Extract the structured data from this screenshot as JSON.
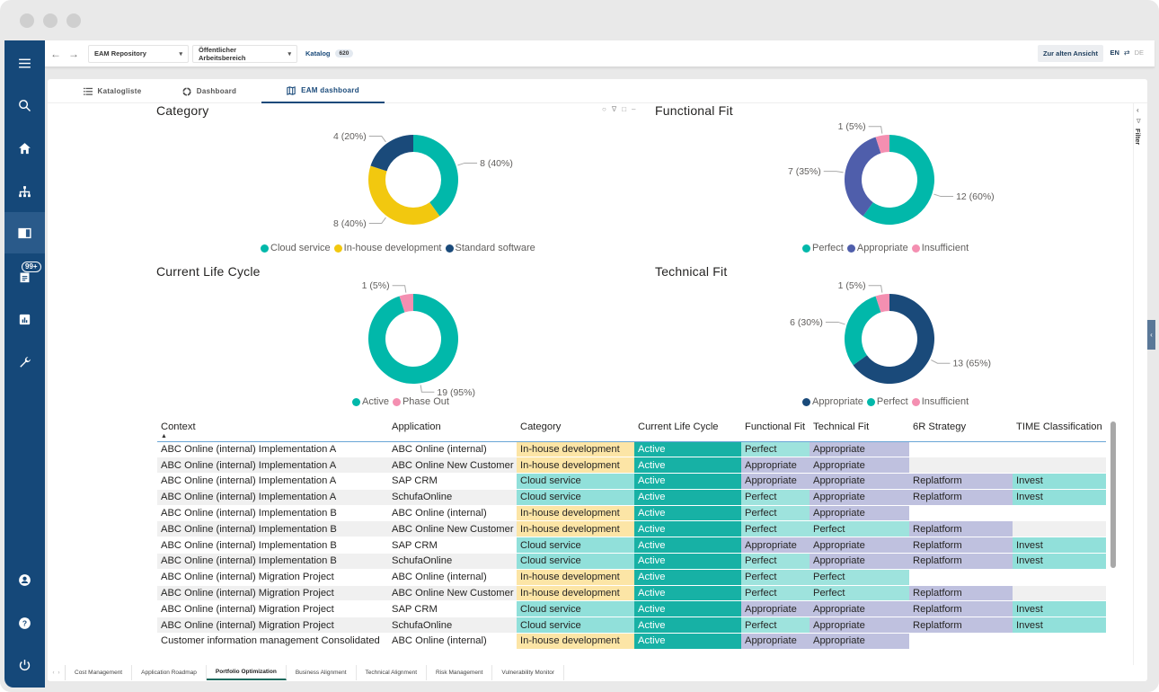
{
  "window": {
    "controls": [
      "close",
      "minimize",
      "maximize"
    ]
  },
  "sidebar": {
    "items": [
      {
        "name": "menu",
        "icon": "hamburger-icon"
      },
      {
        "name": "search",
        "icon": "search-icon"
      },
      {
        "name": "home",
        "icon": "home-icon"
      },
      {
        "name": "hierarchy",
        "icon": "sitemap-icon"
      },
      {
        "name": "catalog",
        "icon": "book-icon",
        "active": true
      },
      {
        "name": "notifications",
        "icon": "document-icon",
        "badge": "99+"
      },
      {
        "name": "reports",
        "icon": "bar-chart-icon"
      },
      {
        "name": "tools",
        "icon": "wrench-icon"
      },
      {
        "name": "profile",
        "icon": "user-icon"
      },
      {
        "name": "help",
        "icon": "help-icon"
      },
      {
        "name": "logout",
        "icon": "power-icon"
      }
    ]
  },
  "topbar": {
    "repository": "EAM Repository",
    "workspace": "Öffentlicher Arbeitsbereich",
    "catalog_label": "Katalog",
    "catalog_count": "620",
    "old_view_button": "Zur alten Ansicht",
    "lang_active": "EN",
    "lang_other": "DE"
  },
  "tabs": [
    {
      "label": "Katalogliste",
      "icon": "list-icon"
    },
    {
      "label": "Dashboard",
      "icon": "donut-icon"
    },
    {
      "label": "EAM dashboard",
      "icon": "map-icon",
      "active": true
    }
  ],
  "filter_pane": {
    "label": "Filter"
  },
  "chart_data": [
    {
      "type": "pie",
      "title": "Category",
      "donut": true,
      "slices": [
        {
          "label": "Cloud service",
          "value": 8,
          "percent": 40,
          "color": "#01B8AA",
          "data_label": "8 (40%)"
        },
        {
          "label": "In-house development",
          "value": 8,
          "percent": 40,
          "color": "#F2C80F",
          "data_label": "8 (40%)"
        },
        {
          "label": "Standard software",
          "value": 4,
          "percent": 20,
          "color": "#1A4A7A",
          "data_label": "4 (20%)"
        }
      ],
      "legend": "bottom"
    },
    {
      "type": "pie",
      "title": "Functional Fit",
      "donut": true,
      "slices": [
        {
          "label": "Perfect",
          "value": 12,
          "percent": 60,
          "color": "#01B8AA",
          "data_label": "12 (60%)"
        },
        {
          "label": "Appropriate",
          "value": 7,
          "percent": 35,
          "color": "#4F5EAB",
          "data_label": "7 (35%)"
        },
        {
          "label": "Insufficient",
          "value": 1,
          "percent": 5,
          "color": "#F48FB1",
          "data_label": "1 (5%)"
        }
      ],
      "legend": "bottom"
    },
    {
      "type": "pie",
      "title": "Current Life Cycle",
      "donut": true,
      "slices": [
        {
          "label": "Active",
          "value": 19,
          "percent": 95,
          "color": "#01B8AA",
          "data_label": "19 (95%)"
        },
        {
          "label": "Phase Out",
          "value": 1,
          "percent": 5,
          "color": "#F48FB1",
          "data_label": "1 (5%)"
        }
      ],
      "legend": "bottom"
    },
    {
      "type": "pie",
      "title": "Technical Fit",
      "donut": true,
      "slices": [
        {
          "label": "Appropriate",
          "value": 13,
          "percent": 65,
          "color": "#1A4A7A",
          "data_label": "13 (65%)"
        },
        {
          "label": "Perfect",
          "value": 6,
          "percent": 30,
          "color": "#01B8AA",
          "data_label": "6 (30%)"
        },
        {
          "label": "Insufficient",
          "value": 1,
          "percent": 5,
          "color": "#F48FB1",
          "data_label": "1 (5%)"
        }
      ],
      "legend": "bottom"
    }
  ],
  "table": {
    "columns": [
      "Context",
      "Application",
      "Category",
      "Current Life Cycle",
      "Functional Fit",
      "Technical Fit",
      "6R Strategy",
      "TIME Classification"
    ],
    "sort_column": "Context",
    "sort_direction": "ascending",
    "rows": [
      [
        "ABC Online (internal) Implementation A",
        "ABC Online (internal)",
        "In-house development",
        "Active",
        "Perfect",
        "Appropriate",
        "",
        ""
      ],
      [
        "ABC Online (internal) Implementation A",
        "ABC Online New Customer",
        "In-house development",
        "Active",
        "Appropriate",
        "Appropriate",
        "",
        ""
      ],
      [
        "ABC Online (internal) Implementation A",
        "SAP CRM",
        "Cloud service",
        "Active",
        "Appropriate",
        "Appropriate",
        "Replatform",
        "Invest"
      ],
      [
        "ABC Online (internal) Implementation A",
        "SchufaOnline",
        "Cloud service",
        "Active",
        "Perfect",
        "Appropriate",
        "Replatform",
        "Invest"
      ],
      [
        "ABC Online (internal) Implementation B",
        "ABC Online (internal)",
        "In-house development",
        "Active",
        "Perfect",
        "Appropriate",
        "",
        ""
      ],
      [
        "ABC Online (internal) Implementation B",
        "ABC Online New Customer",
        "In-house development",
        "Active",
        "Perfect",
        "Perfect",
        "Replatform",
        ""
      ],
      [
        "ABC Online (internal) Implementation B",
        "SAP CRM",
        "Cloud service",
        "Active",
        "Appropriate",
        "Appropriate",
        "Replatform",
        "Invest"
      ],
      [
        "ABC Online (internal) Implementation B",
        "SchufaOnline",
        "Cloud service",
        "Active",
        "Perfect",
        "Appropriate",
        "Replatform",
        "Invest"
      ],
      [
        "ABC Online (internal) Migration Project",
        "ABC Online (internal)",
        "In-house development",
        "Active",
        "Perfect",
        "Perfect",
        "",
        ""
      ],
      [
        "ABC Online (internal) Migration Project",
        "ABC Online New Customer",
        "In-house development",
        "Active",
        "Perfect",
        "Perfect",
        "Replatform",
        ""
      ],
      [
        "ABC Online (internal) Migration Project",
        "SAP CRM",
        "Cloud service",
        "Active",
        "Appropriate",
        "Appropriate",
        "Replatform",
        "Invest"
      ],
      [
        "ABC Online (internal) Migration Project",
        "SchufaOnline",
        "Cloud service",
        "Active",
        "Perfect",
        "Appropriate",
        "Replatform",
        "Invest"
      ],
      [
        "Customer information management Consolidated",
        "ABC Online (internal)",
        "In-house development",
        "Active",
        "Appropriate",
        "Appropriate",
        "",
        ""
      ]
    ]
  },
  "page_tabs": [
    {
      "label": "Cost Management"
    },
    {
      "label": "Application Roadmap"
    },
    {
      "label": "Portfolio Optimization",
      "active": true
    },
    {
      "label": "Business Alignment"
    },
    {
      "label": "Technical Alignment"
    },
    {
      "label": "Risk Management"
    },
    {
      "label": "Vulnerability Monitor"
    }
  ]
}
